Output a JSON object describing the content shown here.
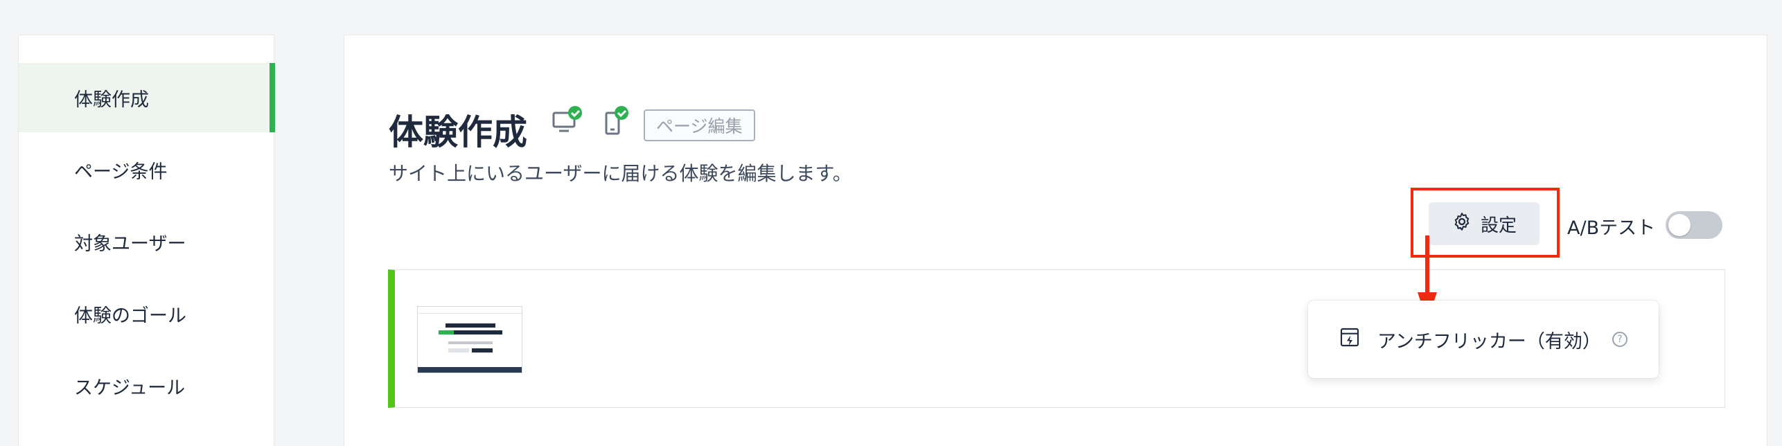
{
  "sidebar": {
    "items": [
      {
        "label": "体験作成",
        "active": true
      },
      {
        "label": "ページ条件",
        "active": false
      },
      {
        "label": "対象ユーザー",
        "active": false
      },
      {
        "label": "体験のゴール",
        "active": false
      },
      {
        "label": "スケジュール",
        "active": false
      }
    ]
  },
  "header": {
    "title": "体験作成",
    "page_edit_chip": "ページ編集",
    "subtitle": "サイト上にいるユーザーに届ける体験を編集します。",
    "device_icons": [
      "desktop-check-icon",
      "mobile-check-icon"
    ]
  },
  "toolbar": {
    "settings_label": "設定",
    "ab_test_label": "A/Bテスト",
    "ab_test_enabled": false
  },
  "dropdown": {
    "item_label": "アンチフリッカー（有効）",
    "help_glyph": "?"
  },
  "colors": {
    "accent_green": "#2fb152",
    "highlight_red": "#f02b12",
    "card_border_green": "#52c41a"
  }
}
